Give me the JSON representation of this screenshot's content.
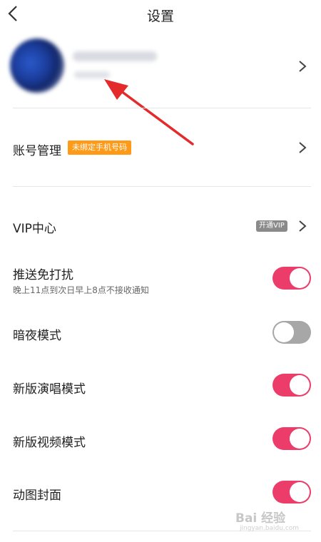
{
  "header": {
    "title": "设置",
    "back_icon": "chevron-left-icon"
  },
  "profile": {
    "chevron_icon": "chevron-right-icon",
    "annotation_icon": "red-arrow-icon"
  },
  "account": {
    "label": "账号管理",
    "badge": "未绑定手机号码",
    "badge_color": "#ff9a18"
  },
  "vip": {
    "label": "VIP中心",
    "badge": "开通VIP"
  },
  "settings": [
    {
      "label": "推送免打扰",
      "sub": "晚上11点到次日早上8点不接收通知",
      "on": true
    },
    {
      "label": "暗夜模式",
      "on": false
    },
    {
      "label": "新版演唱模式",
      "on": true
    },
    {
      "label": "新版视频模式",
      "on": true
    },
    {
      "label": "动图封面",
      "on": true
    }
  ],
  "colors": {
    "toggle_on": "#ec3d6a",
    "toggle_off": "#a7a7a7"
  },
  "watermark": {
    "text": "Bai 经验",
    "sub": "jingyan.baidu.com"
  }
}
